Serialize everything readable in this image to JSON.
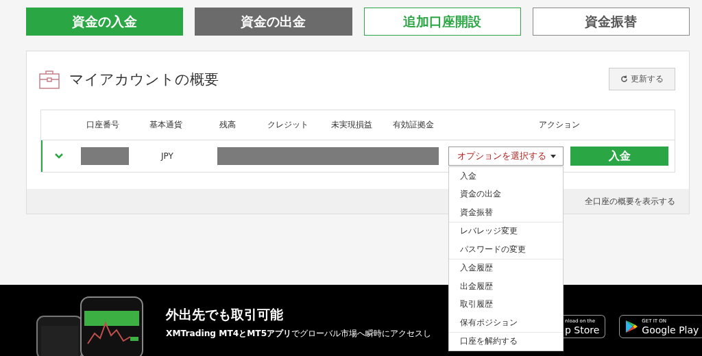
{
  "top_buttons": [
    {
      "label": "資金の入金",
      "kind": "green"
    },
    {
      "label": "資金の出金",
      "kind": "grey"
    },
    {
      "label": "追加口座開設",
      "kind": "outline-green"
    },
    {
      "label": "資金振替",
      "kind": "outline-grey"
    }
  ],
  "account_summary": {
    "title": "マイアカウントの概要",
    "refresh_button": "更新する",
    "table": {
      "columns": [
        "口座番号",
        "基本通貨",
        "残高",
        "クレジット",
        "未実現損益",
        "有効証拠金",
        "アクション"
      ],
      "rows": [
        {
          "expanded": false,
          "currency": "JPY",
          "action_select": {
            "placeholder": "オプションを選択する",
            "expanded": true,
            "menu_groups": [
              [
                "入金",
                "資金の出金",
                "資金振替"
              ],
              [
                "レバレッジ変更",
                "パスワードの変更"
              ],
              [
                "入金履歴",
                "出金履歴",
                "取引履歴",
                "保有ポジション"
              ],
              [
                "口座を解約する"
              ]
            ]
          },
          "deposit_button": "入金"
        }
      ]
    },
    "footer_link": "全口座の概要を表示する"
  },
  "promo": {
    "title": "外出先でも取引可能",
    "subtitle": "**XMTrading MT4とMT5アプリ**でグローバル市場へ瞬時にアクセスし",
    "app_store": {
      "small": "nload on the",
      "big": "p Store"
    },
    "google_play": {
      "small": "GET IT ON",
      "big": "Google Play"
    }
  }
}
